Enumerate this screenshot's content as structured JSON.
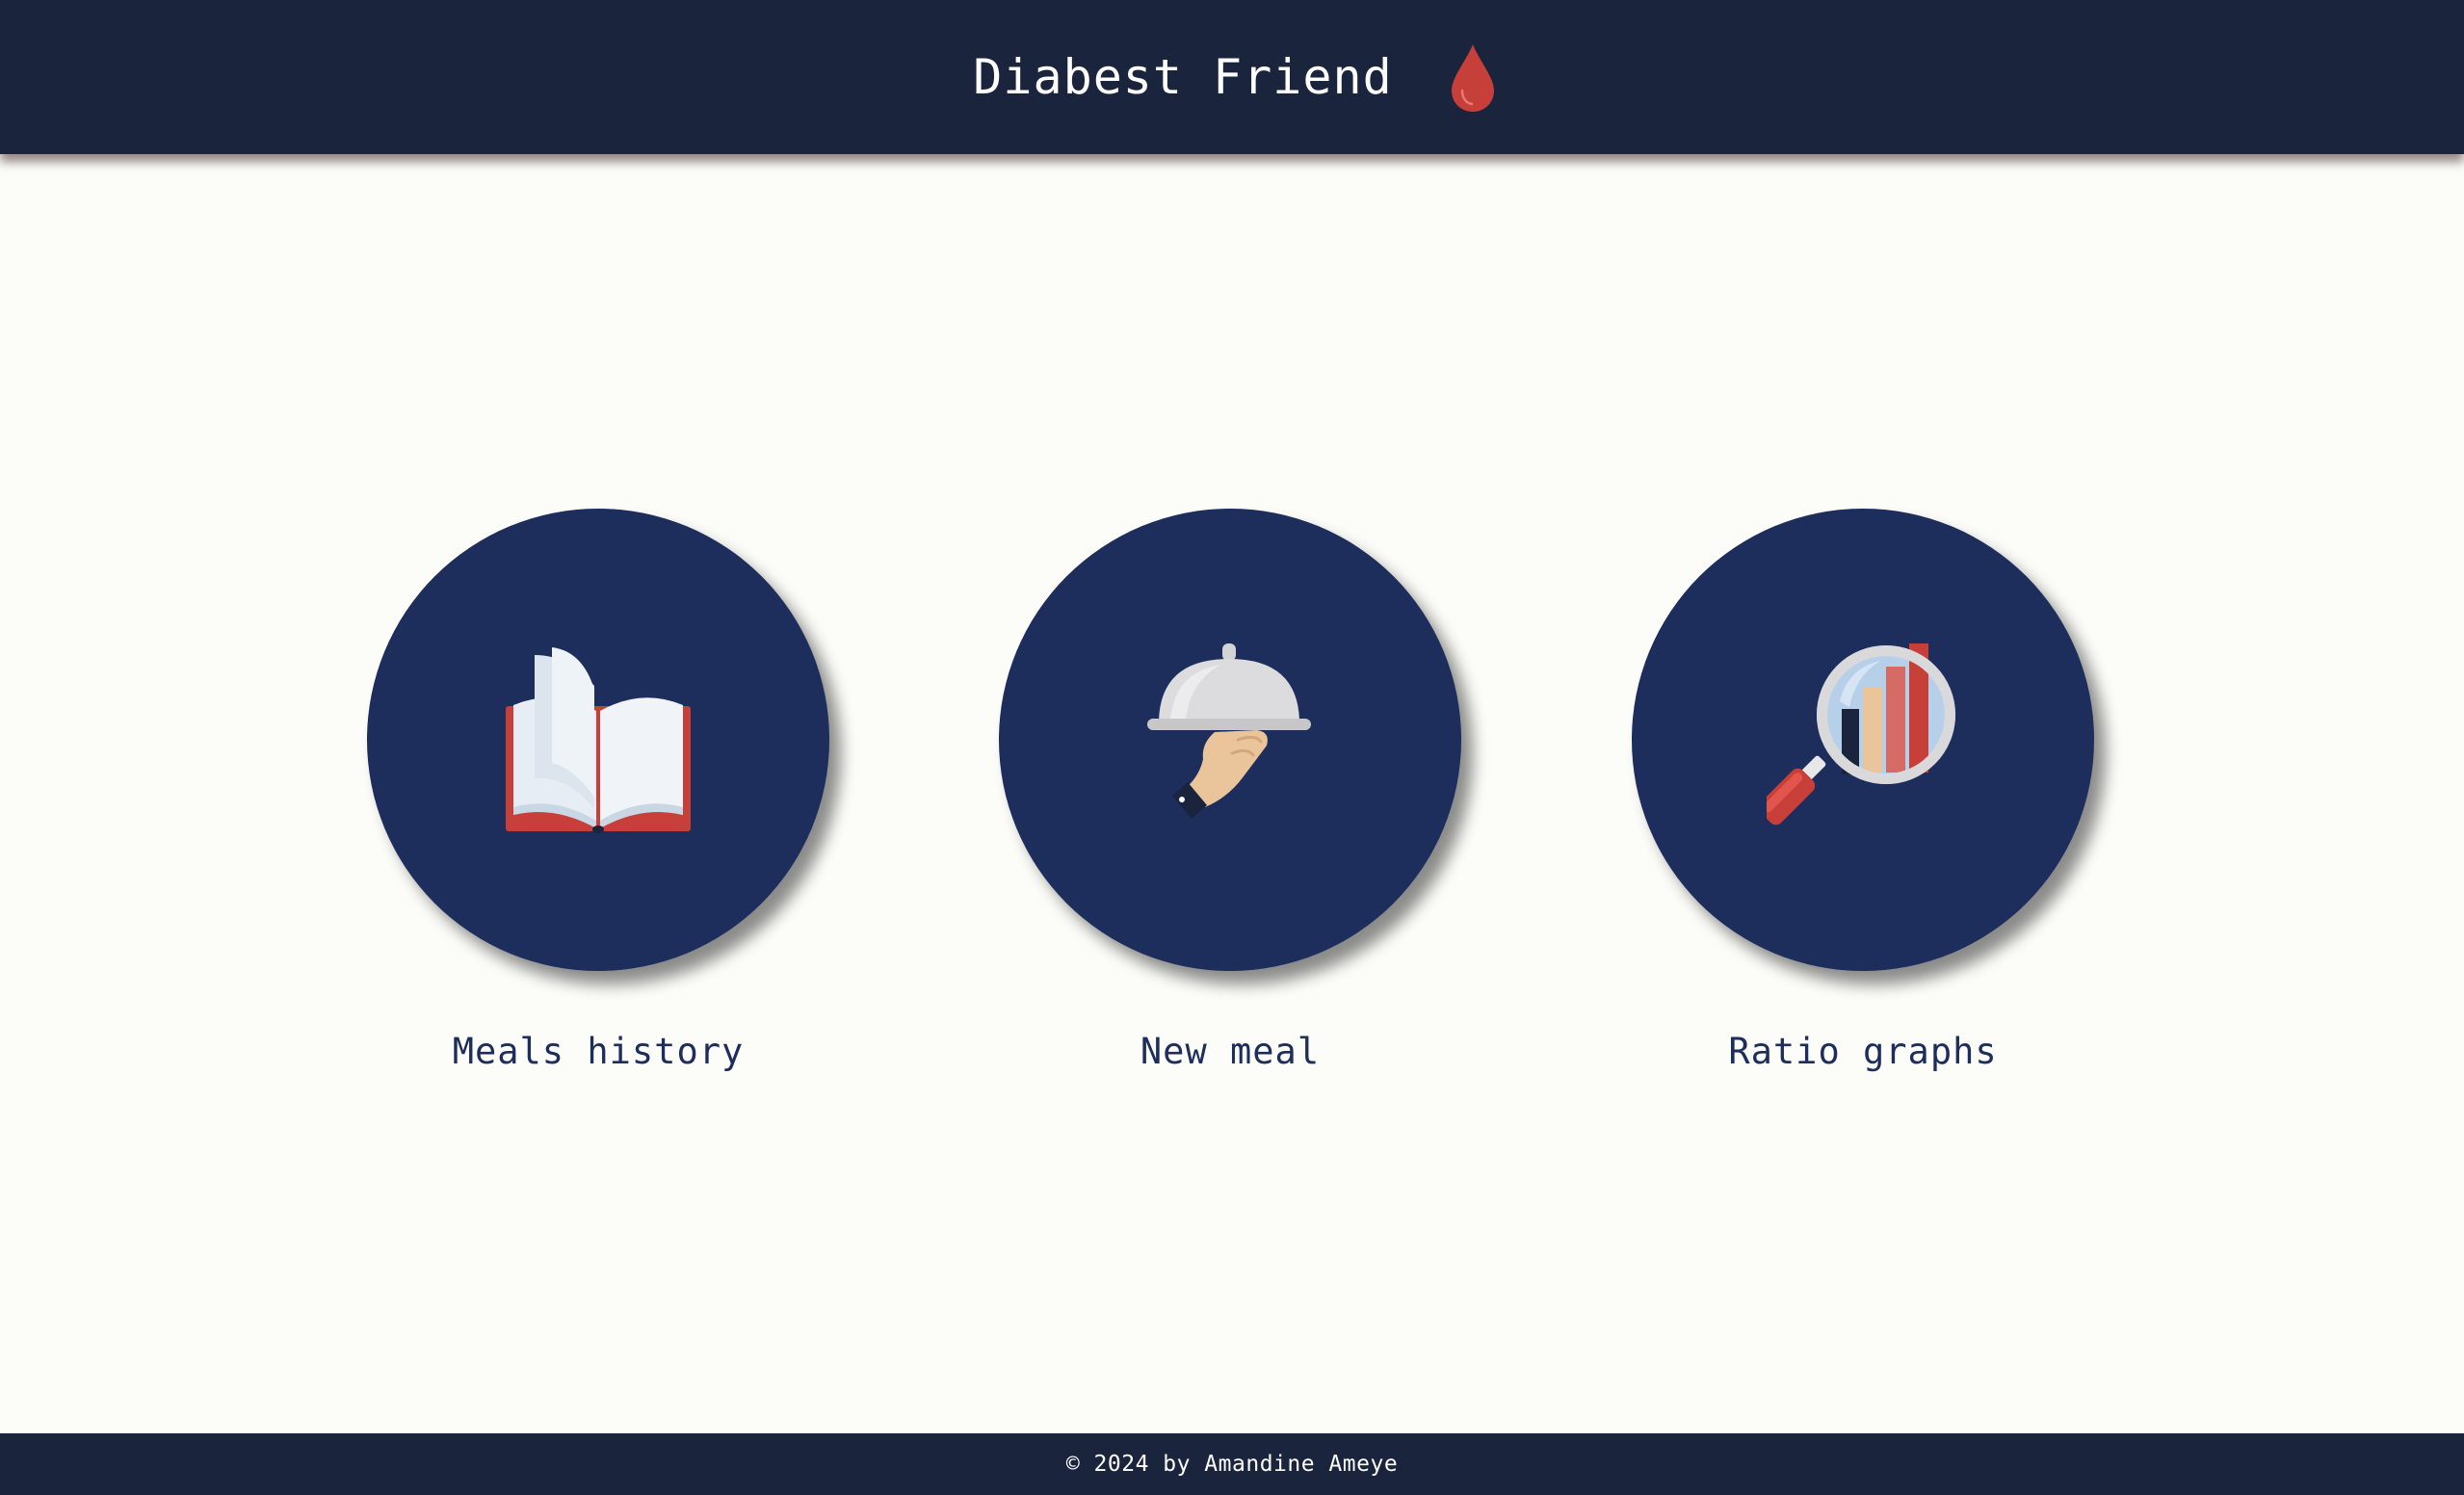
{
  "header": {
    "title": "Diabest Friend",
    "logo_icon": "blood-drop-icon",
    "logo_color": "#c63f38",
    "background": "#1b243d"
  },
  "menu": {
    "items": [
      {
        "label": "Meals history",
        "icon": "open-book-icon"
      },
      {
        "label": "New meal",
        "icon": "serving-cloche-hand-icon"
      },
      {
        "label": "Ratio graphs",
        "icon": "magnifier-bar-chart-icon"
      }
    ],
    "circle_color": "#1d2d5c",
    "label_color": "#1d2d5c"
  },
  "footer": {
    "text": "© 2024 by Amandine Ameye"
  }
}
